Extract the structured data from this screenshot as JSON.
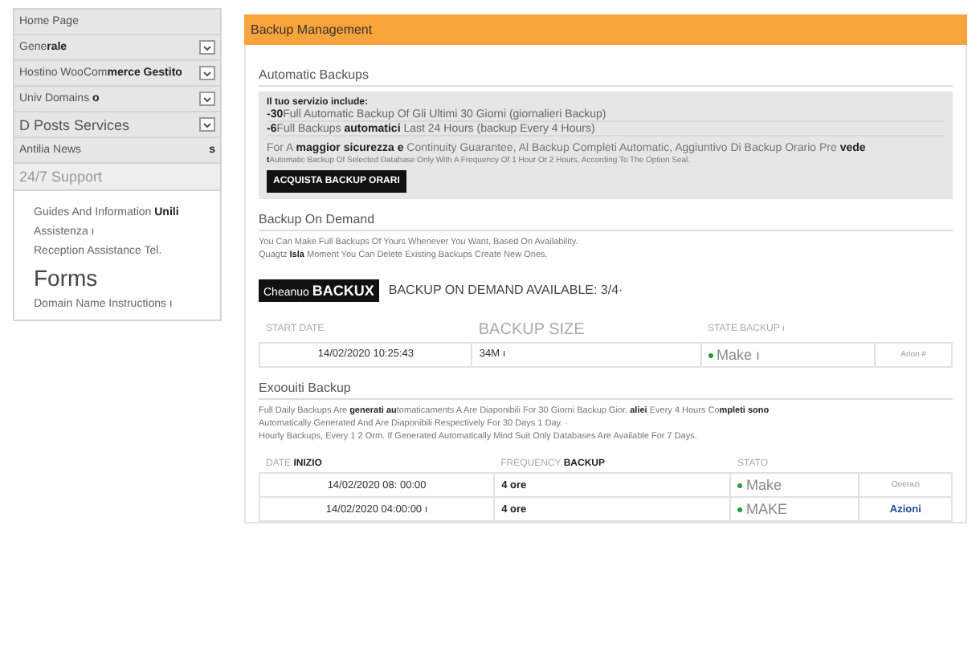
{
  "sidebar": {
    "items": [
      {
        "kind": "link",
        "label": "Home Page",
        "large": false
      },
      {
        "kind": "dropdown",
        "label": "Gene**rale**",
        "large": false
      },
      {
        "kind": "dropdown",
        "label": "Hostino WooCom**merce Gestito**",
        "large": false
      },
      {
        "kind": "dropdown",
        "label": "Univ Domains **o**",
        "large": false
      },
      {
        "kind": "dropdown",
        "label": "D Posts Services",
        "large": true
      },
      {
        "kind": "link",
        "label": "Antilia News **s**",
        "large": false
      },
      {
        "kind": "header",
        "label": "24/7 Support"
      }
    ],
    "submenu": [
      {
        "label": "Guides And Information **Unili**",
        "large": false
      },
      {
        "label": "Assistenza ı",
        "large": false
      },
      {
        "label": "Reception Assistance Tel.",
        "large": false
      },
      {
        "label": "Forms",
        "large": true
      },
      {
        "label": "Domain Name Instructions ı",
        "large": false
      }
    ]
  },
  "main": {
    "title": "Backup Management",
    "automatic": {
      "heading": "Automatic Backups",
      "intro": "Il tuo servizio include:",
      "lines": [
        "**-30**Full Automatic Backup Of Gli Ultimi 30 Giorni (giornalieri Backup)",
        "**-6**Full Backups **automatici** Last 24 Hours (backup Every 4 Hours)"
      ],
      "note": "For A **maggior sicurezza e** Continuity Guarantee, Al Backup Completi Automatic, Aggiuntivo Di Backup Orario Pre **vede**",
      "note2": "**t**Automatic Backup Of Selected Database Only With A Frequency Of 1 Hour Or 2 Hours, According To The Option Seal.",
      "button": "ACQUISTA BACKUP ORARI"
    },
    "on_demand": {
      "heading": "Backup On Demand",
      "text": [
        "You Can Make Full Backups Of Yours Whenever You Want, Based On Availability.",
        "Quagtz **Isla** Moment You Can Delete Existing Backups Create New Ones."
      ],
      "button": "Cheanuo **BACKUX**",
      "available": "BACKUP ON DEMAND AVAILABLE: 3/4·",
      "columns": [
        "START DATE",
        "BACKUP SIZE",
        "STATE BACKUP ı"
      ],
      "rows": [
        {
          "date": "14/02/2020 10:25:43",
          "size": "34M ı",
          "state": "Make ı",
          "action": "Arion #",
          "link": false
        }
      ]
    },
    "executed": {
      "heading": "Exoouiti Backup",
      "text": [
        "Full Daily Backups Are **generati au**tomaticaments A Are Diaponibili For 30 Giorni Backup Gior. **aliei** Every 4 Hours Co**mpleti sono**",
        "Automatically Generated And Are Diaponibili Respectively For 30 Days 1 Day. ·",
        "Hourly Backups, Every 1 2 Orm. If Generated Automatically Mind Suit Only Databases Are Available For 7 Days."
      ],
      "columns": [
        "DATE **INIZIO**",
        "FREQUENCY **BACKUP**",
        "STATO"
      ],
      "rows": [
        {
          "date": "14/02/2020 08: 00:00",
          "freq": "4 ore",
          "state": "Make",
          "action": "Ooerazi",
          "link": false
        },
        {
          "date": "14/02/2020 04:00:00 ı",
          "freq": "4 ore",
          "state": "MAKE",
          "action": "Azioni",
          "link": true
        }
      ]
    }
  }
}
